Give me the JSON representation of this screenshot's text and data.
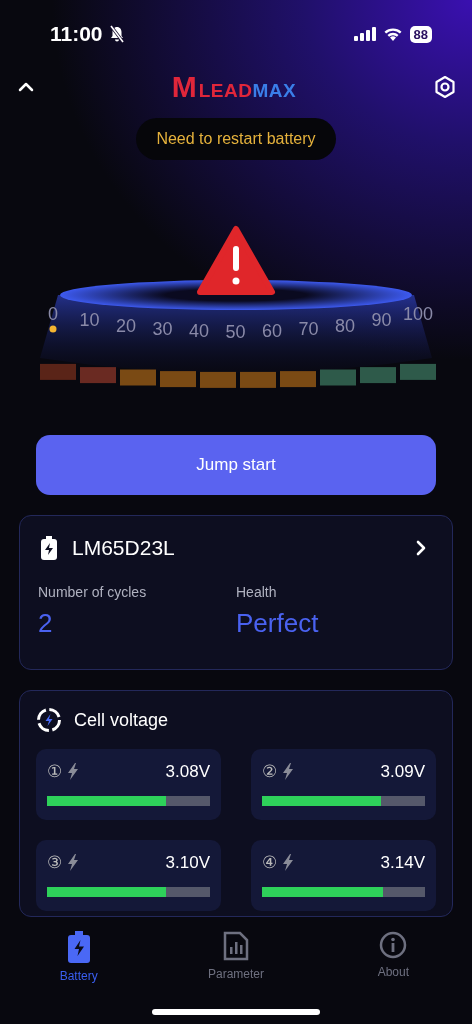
{
  "status_bar": {
    "time": "11:00",
    "silent": true,
    "battery": "88"
  },
  "header": {
    "logo": {
      "mark": "M",
      "part_1": "LEAD",
      "part_2": "MAX"
    }
  },
  "alert": {
    "message": "Need to restart battery"
  },
  "gauge": {
    "scale": [
      "0",
      "10",
      "20",
      "30",
      "40",
      "50",
      "60",
      "70",
      "80",
      "90",
      "100"
    ]
  },
  "action_button": {
    "label": "Jump start"
  },
  "battery_card": {
    "model": "LM65D23L",
    "stats": [
      {
        "label": "Number of cycles",
        "value": "2"
      },
      {
        "label": "Health",
        "value": "Perfect"
      }
    ]
  },
  "cell_voltage": {
    "title": "Cell voltage",
    "cells": [
      {
        "index": "①",
        "voltage": "3.08V",
        "level": 0.73
      },
      {
        "index": "②",
        "voltage": "3.09V",
        "level": 0.73
      },
      {
        "index": "③",
        "voltage": "3.10V",
        "level": 0.73
      },
      {
        "index": "④",
        "voltage": "3.14V",
        "level": 0.74
      }
    ]
  },
  "tabs": [
    {
      "label": "Battery",
      "kind": "battery",
      "selected": true
    },
    {
      "label": "Parameter",
      "kind": "parameter",
      "selected": false
    },
    {
      "label": "About",
      "kind": "about",
      "selected": false
    }
  ]
}
